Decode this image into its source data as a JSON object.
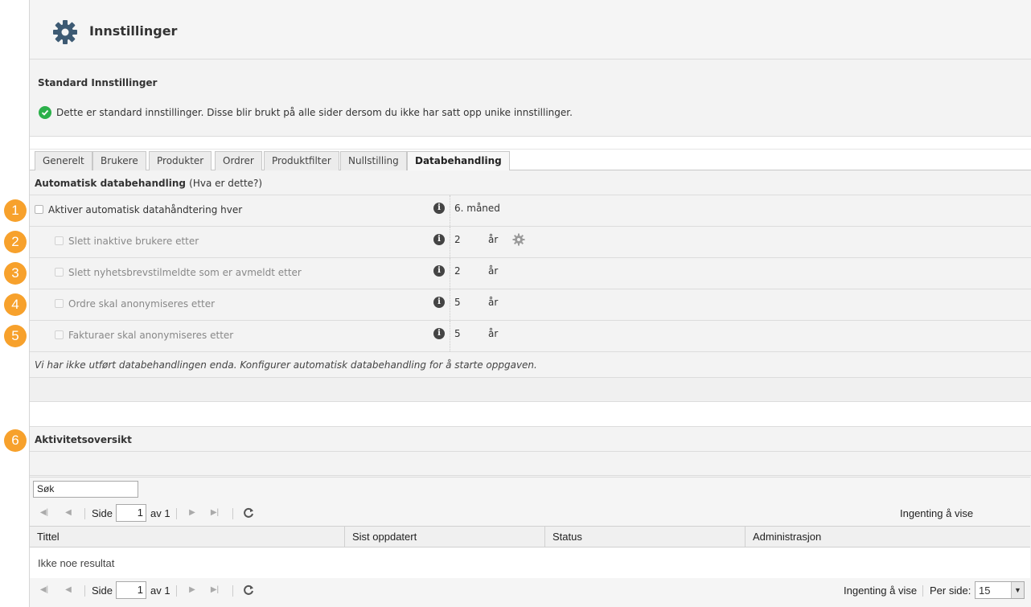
{
  "header": {
    "title": "Innstillinger"
  },
  "standard": {
    "heading": "Standard Innstillinger",
    "message": "Dette er standard innstillinger. Disse blir brukt på alle sider dersom du ikke har satt opp unike innstillinger."
  },
  "tabs": [
    {
      "label": "Generelt",
      "active": false
    },
    {
      "label": "Brukere",
      "active": false
    },
    {
      "label": "Produkter",
      "active": false
    },
    {
      "label": "Ordrer",
      "active": false
    },
    {
      "label": "Produktfilter",
      "active": false
    },
    {
      "label": "Nullstilling",
      "active": false
    },
    {
      "label": "Databehandling",
      "active": true
    }
  ],
  "section": {
    "title": "Automatisk databehandling",
    "hint": "(Hva er dette?)"
  },
  "rows": [
    {
      "label": "Aktiver automatisk datahåndtering hver",
      "value": "6. måned",
      "unit": "",
      "checked": false
    },
    {
      "label": "Slett inaktive brukere etter",
      "value": "2",
      "unit": "år",
      "checked": false
    },
    {
      "label": "Slett nyhetsbrevstilmeldte som er avmeldt etter",
      "value": "2",
      "unit": "år",
      "checked": false
    },
    {
      "label": "Ordre skal anonymiseres etter",
      "value": "5",
      "unit": "år",
      "checked": false
    },
    {
      "label": "Fakturaer skal anonymiseres etter",
      "value": "5",
      "unit": "år",
      "checked": false
    }
  ],
  "note": "Vi har ikke utført databehandlingen enda. Konfigurer automatisk databehandling for å starte oppgaven.",
  "activity": {
    "title": "Aktivitetsoversikt"
  },
  "grid": {
    "search_value": "Søk",
    "page_label": "Side",
    "page_value": "1",
    "of_label": "av 1",
    "empty_label": "Ingenting å vise",
    "per_page_label": "Per side:",
    "per_page_value": "15",
    "columns": [
      "Tittel",
      "Sist oppdatert",
      "Status",
      "Administrasjon"
    ],
    "no_result": "Ikke noe resultat"
  },
  "badges": [
    "1",
    "2",
    "3",
    "4",
    "5",
    "6"
  ],
  "colors": {
    "badge": "#f7a12c",
    "ok": "#2bb04a"
  },
  "icons": {
    "header": "gear-icon",
    "info": "info-icon",
    "settings": "cog-icon",
    "refresh": "refresh-icon",
    "ok": "check-circle-icon"
  }
}
